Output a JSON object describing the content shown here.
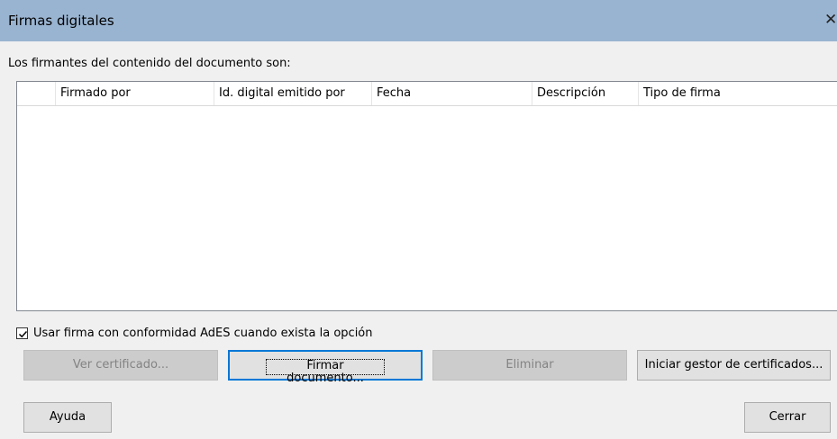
{
  "window": {
    "title": "Firmas digitales",
    "close_glyph": "✕"
  },
  "intro_text": "Los firmantes del contenido del documento son:",
  "table": {
    "columns": [
      "",
      "Firmado por",
      "Id. digital emitido por",
      "Fecha",
      "Descripción",
      "Tipo de firma"
    ],
    "rows": []
  },
  "ades_checkbox": {
    "label": "Usar firma con conformidad AdES cuando exista la opción",
    "checked": true
  },
  "buttons": {
    "view_certificate": "Ver certificado...",
    "sign_document": "Firmar documento...",
    "remove": "Eliminar",
    "start_cert_manager": "Iniciar gestor de certificados...",
    "help": "Ayuda",
    "close": "Cerrar"
  },
  "colors": {
    "titlebar": "#99b4d1",
    "dialog_bg": "#f0f0f0",
    "focus_border": "#0078d7"
  }
}
